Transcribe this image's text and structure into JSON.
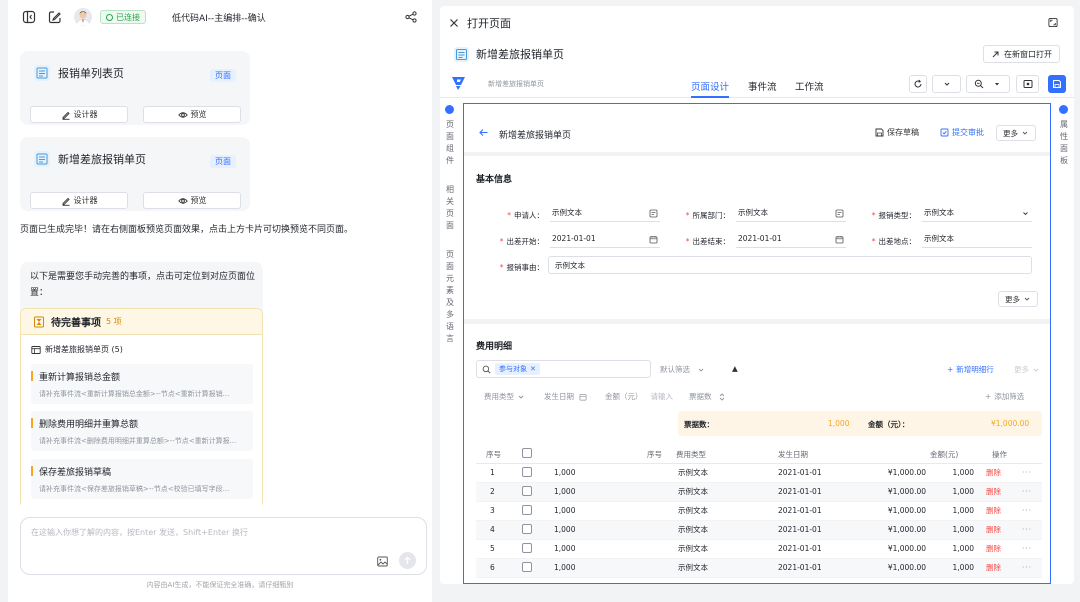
{
  "left": {
    "header": {
      "status": "已连接",
      "title": "低代码AI--主编排--确认"
    },
    "cards": [
      {
        "title": "报销单列表页",
        "tag": "页面",
        "designer": "设计器",
        "preview": "预览"
      },
      {
        "title": "新增差旅报销单页",
        "tag": "页面",
        "designer": "设计器",
        "preview": "预览"
      }
    ],
    "message": "页面已生成完毕！请在右侧面板预览页面效果，点击上方卡片可切换预览不同页面。",
    "todo": {
      "intro": "以下是需要您手动完善的事项，点击可定位到对应页面位置：",
      "title": "待完善事项",
      "count": "5 项",
      "group": "新增差旅报销单页 (5)",
      "items": [
        {
          "title": "重新计算报销总金额",
          "sub": "请补充事件流<重新计算报销总金额>--节点<重新计算报销..."
        },
        {
          "title": "删除费用明细并重算总额",
          "sub": "请补充事件流<删除费用明细并重算总额>--节点<重新计算报..."
        },
        {
          "title": "保存差旅报销草稿",
          "sub": "请补充事件流<保存差旅报销草稿>--节点<校验已填写字段..."
        }
      ]
    },
    "input_placeholder": "在这输入你想了解的内容，按Enter 发送，Shift+Enter 换行",
    "footnote": "内容由AI生成，不能保证完全准确，请仔细甄别"
  },
  "right": {
    "title": "打开页面",
    "page_name": "新增差旅报销单页",
    "open_new_window": "在新窗口打开",
    "breadcrumb": "新增差旅报销单页",
    "tabs": [
      "页面设计",
      "事件流",
      "工作流"
    ],
    "side_left": [
      "页面组件",
      "相关页面",
      "页面元素及多语言"
    ],
    "side_right": "属性面板",
    "form": {
      "title": "新增差旅报销单页",
      "save_draft": "保存草稿",
      "submit": "提交审批",
      "more": "更多",
      "basic_title": "基本信息",
      "fields": [
        {
          "label": "申请人：",
          "value": "示例文本"
        },
        {
          "label": "所属部门：",
          "value": "示例文本"
        },
        {
          "label": "报销类型：",
          "value": "示例文本"
        },
        {
          "label": "出差开始：",
          "value": "2021-01-01"
        },
        {
          "label": "出差结束：",
          "value": "2021-01-01"
        },
        {
          "label": "出差地点：",
          "value": "示例文本"
        },
        {
          "label": "报销事由：",
          "value": "示例文本"
        }
      ],
      "expense_title": "费用明细",
      "filter_chip": "参与对象",
      "default_filter": "默认筛选",
      "add_row": "新增明细行",
      "more2": "更多",
      "group_fields": [
        "费用类型",
        "发生日期",
        "金额（元）",
        "请输入",
        "票据数"
      ],
      "add_filter": "添加筛选",
      "summary": {
        "label1": "票据数：",
        "value1": "1,000",
        "label2": "金额（元）：",
        "value2": "¥1,000.00"
      },
      "table": {
        "headers": [
          "序号",
          "",
          "序号",
          "费用类型",
          "发生日期",
          "金额(元)",
          "",
          "操作"
        ],
        "rows": [
          [
            "1",
            "1,000",
            "示例文本",
            "2021-01-01",
            "¥1,000.00",
            "1,000"
          ],
          [
            "2",
            "1,000",
            "示例文本",
            "2021-01-01",
            "¥1,000.00",
            "1,000"
          ],
          [
            "3",
            "1,000",
            "示例文本",
            "2021-01-01",
            "¥1,000.00",
            "1,000"
          ],
          [
            "4",
            "1,000",
            "示例文本",
            "2021-01-01",
            "¥1,000.00",
            "1,000"
          ],
          [
            "5",
            "1,000",
            "示例文本",
            "2021-01-01",
            "¥1,000.00",
            "1,000"
          ],
          [
            "6",
            "1,000",
            "示例文本",
            "2021-01-01",
            "¥1,000.00",
            "1,000"
          ]
        ],
        "delete": "删除",
        "dots": "···"
      }
    }
  },
  "colors": {
    "primary": "#3370ff",
    "danger": "#f54a45",
    "warning": "#f5a623",
    "success": "#2ba24c"
  }
}
